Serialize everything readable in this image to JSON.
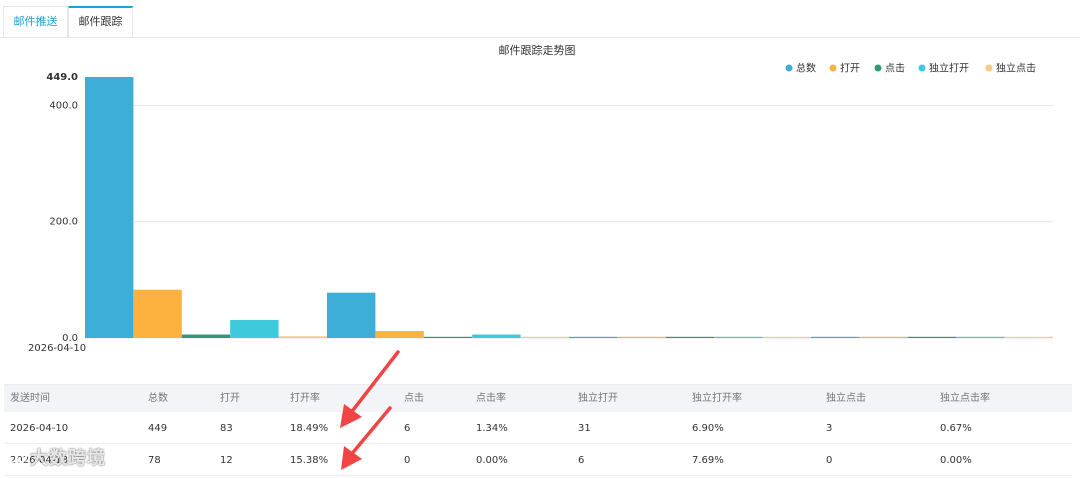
{
  "tabs": [
    {
      "label": "邮件推送"
    },
    {
      "label": "邮件跟踪"
    }
  ],
  "colors": {
    "total": "#3daed8",
    "open": "#fdb13f",
    "click": "#2b9c7a",
    "unique_open": "#3ec9dc",
    "unique_click": "#f7ca82",
    "accent": "#1aa1d6",
    "arrow": "#f14545"
  },
  "chart_data": {
    "type": "bar",
    "title": "邮件跟踪走势图",
    "categories": [
      "2026-04-10",
      "2026-04-13",
      "",
      ""
    ],
    "x_tick_labels": [
      "2026-04-10"
    ],
    "series": [
      {
        "name": "总数",
        "values": [
          449,
          78,
          0,
          0
        ]
      },
      {
        "name": "打开",
        "values": [
          83,
          12,
          0,
          0
        ]
      },
      {
        "name": "点击",
        "values": [
          6,
          0,
          0,
          0
        ]
      },
      {
        "name": "独立打开",
        "values": [
          31,
          6,
          0,
          0
        ]
      },
      {
        "name": "独立点击",
        "values": [
          3,
          0,
          0,
          0
        ]
      }
    ],
    "y_ticks": [
      "0.0",
      "200.0",
      "400.0",
      "449.0"
    ],
    "ylim": [
      0,
      449
    ],
    "legend_position": "top-right",
    "grid": true
  },
  "table": {
    "headers": [
      "发送时间",
      "总数",
      "打开",
      "打开率",
      "点击",
      "点击率",
      "独立打开",
      "独立打开率",
      "独立点击",
      "独立点击率"
    ],
    "rows": [
      [
        "2026-04-10",
        "449",
        "83",
        "18.49%",
        "6",
        "1.34%",
        "31",
        "6.90%",
        "3",
        "0.67%"
      ],
      [
        "2026-04-13",
        "78",
        "12",
        "15.38%",
        "0",
        "0.00%",
        "6",
        "7.69%",
        "0",
        "0.00%"
      ]
    ]
  },
  "watermark": {
    "text": "大数跨境"
  }
}
